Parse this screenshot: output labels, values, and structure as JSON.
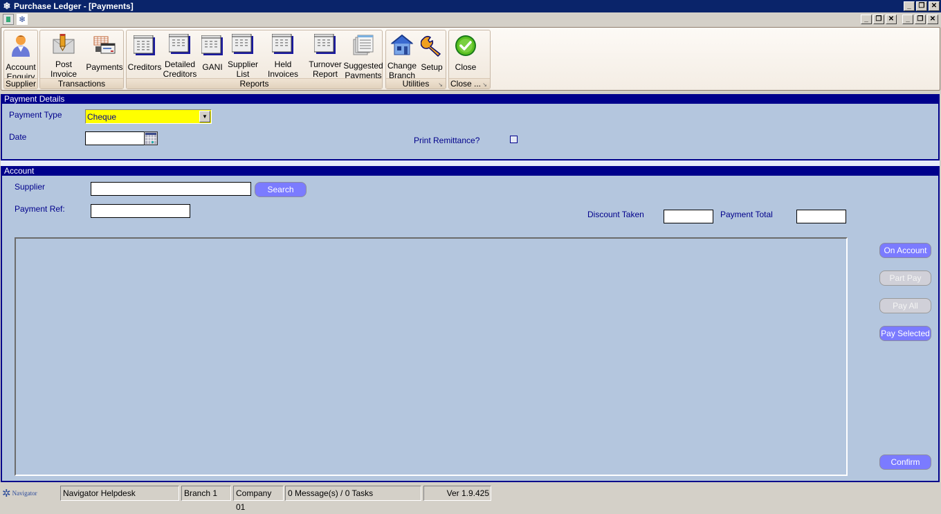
{
  "window": {
    "title": "Purchase Ledger - [Payments]",
    "app_icon": "navigator-snowflake-icon",
    "controls": [
      "minimize",
      "restore",
      "close"
    ]
  },
  "mdi": {
    "icons": [
      "window-icon",
      "navigator-snowflake-icon"
    ],
    "controls_set_1": [
      "minimize",
      "restore",
      "close"
    ],
    "controls_set_2": [
      "minimize",
      "restore",
      "close"
    ]
  },
  "ribbon": {
    "groups": [
      {
        "caption": "Supplier",
        "buttons": [
          {
            "label": "Account\nEnquiry",
            "l1": "Account",
            "l2": "Enquiry",
            "icon": "user-icon"
          }
        ]
      },
      {
        "caption": "Transactions",
        "buttons": [
          {
            "l1": "Post Invoice",
            "l2": "",
            "icon": "post-invoice-icon"
          },
          {
            "l1": "Payments",
            "l2": "",
            "icon": "payments-icon"
          }
        ]
      },
      {
        "caption": "Reports",
        "buttons": [
          {
            "l1": "Creditors",
            "l2": "",
            "icon": "report-icon"
          },
          {
            "l1": "Detailed",
            "l2": "Creditors",
            "icon": "report-icon"
          },
          {
            "l1": "GANI",
            "l2": "",
            "icon": "report-icon"
          },
          {
            "l1": "Supplier",
            "l2": "List",
            "icon": "report-icon"
          },
          {
            "l1": "Held Invoices",
            "l2": "",
            "icon": "report-icon"
          },
          {
            "l1": "Turnover",
            "l2": "Report",
            "icon": "report-icon"
          },
          {
            "l1": "Suggested",
            "l2": "Payments",
            "icon": "documents-icon"
          }
        ]
      },
      {
        "caption": "Utilities",
        "buttons": [
          {
            "l1": "Change",
            "l2": "Branch",
            "icon": "house-icon"
          },
          {
            "l1": "Setup",
            "l2": "",
            "icon": "wrench-icon"
          }
        ]
      },
      {
        "caption": "Close ...",
        "buttons": [
          {
            "l1": "Close",
            "l2": "",
            "icon": "green-check-icon"
          }
        ]
      }
    ]
  },
  "payment_details": {
    "header": "Payment Details",
    "payment_type_label": "Payment Type",
    "payment_type_value": "Cheque",
    "date_label": "Date",
    "date_value": "",
    "print_remittance_label": "Print Remittance?",
    "print_remittance_checked": false
  },
  "account": {
    "header": "Account",
    "supplier_label": "Supplier",
    "supplier_value": "",
    "search_label": "Search",
    "payment_ref_label": "Payment Ref:",
    "payment_ref_value": "",
    "discount_taken_label": "Discount Taken",
    "discount_taken_value": "",
    "payment_total_label": "Payment Total",
    "payment_total_value": ""
  },
  "actions": {
    "on_account": "On Account",
    "part_pay": "Part Pay",
    "pay_all": "Pay All",
    "pay_selected": "Pay Selected",
    "confirm": "Confirm"
  },
  "statusbar": {
    "logo": "Navigator",
    "helpdesk": "Navigator Helpdesk",
    "branch": "Branch 1",
    "company": "Company 01",
    "messages": "0 Message(s) / 0 Tasks",
    "version": "Ver 1.9.425"
  },
  "colors": {
    "titlebar": "#0a246a",
    "section_header": "#00008b",
    "panel_bg": "#b4c6de",
    "button_active": "#7b7bff",
    "dropdown_highlight": "#ffff00"
  }
}
